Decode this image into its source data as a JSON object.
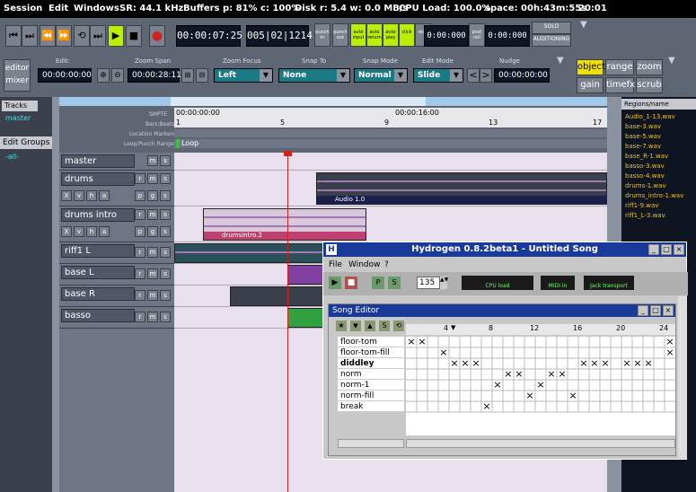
{
  "menubar": {
    "items": [
      "Session",
      "Edit",
      "Windows"
    ],
    "status": [
      "SR: 44.1 kHz",
      "Buffers p: 81% c: 100%",
      "Disk r: 5.4 w: 0.0 MB/s",
      "CPU Load: 100.0%",
      "space: 00h:43m:55s",
      "20:01"
    ]
  },
  "transport": {
    "clock1": "00:00:07:25",
    "clock2": "005|02|1214",
    "buttons": [
      {
        "label": "punch in"
      },
      {
        "label": "punch out"
      },
      {
        "label": "auto input"
      },
      {
        "label": "auto return"
      },
      {
        "label": "auto play"
      },
      {
        "label": "click"
      },
      {
        "label": "stop"
      }
    ],
    "clock3": "0:00:000",
    "clock4": "0:00:000",
    "preroll": "pre roll",
    "postroll": "post roll",
    "sold_label": "SOLO",
    "audition_label": "AUDITIONING"
  },
  "toolbar2": {
    "editor_label": "editor",
    "mixer_label": "mixer",
    "edit_label": "Edit:",
    "edit_value": "00:00:00:00",
    "zoom_span_label": "Zoom Span",
    "zoom_span_value": "00:00:28:11",
    "zoom_focus_label": "Zoom Focus",
    "zoom_focus_value": "Left",
    "snap_to_label": "Snap To",
    "snap_to_value": "None",
    "snap_mode_label": "Snap Mode",
    "snap_mode_value": "Normal",
    "edit_mode_label": "Edit Mode",
    "edit_mode_value": "Slide",
    "nudge_label": "Nudge",
    "nudge_value": "00:00:00:00",
    "modes": [
      "object",
      "range",
      "zoom",
      "gain",
      "timefx",
      "scrub"
    ]
  },
  "left": {
    "tracks_tab": "Tracks",
    "tracks_item": "master",
    "edit_groups_tab": "Edit Groups",
    "all_label": "-all-"
  },
  "ruler": {
    "labels": [
      "SMPTE",
      "Bars:Beats",
      "Location Markers",
      "Loop/Punch Ranges"
    ],
    "smpte_values": [
      "00:00:00:00",
      "00:00:16:00"
    ],
    "bar_values": [
      "1",
      "5",
      "9",
      "13",
      "17"
    ],
    "loop_label": "Loop"
  },
  "tracks": [
    {
      "name": "master"
    },
    {
      "name": "drums"
    },
    {
      "name": "drums intro"
    },
    {
      "name": "riff1 L"
    },
    {
      "name": "base L"
    },
    {
      "name": "base R"
    },
    {
      "name": "basso"
    }
  ],
  "regions": {
    "drums_region": "Audio 1.0",
    "drums_intro_region": "drumsintro.2"
  },
  "region_list": {
    "header": "Regions/name",
    "items": [
      "Audio_1-13.wav",
      "base-3.wav",
      "base-5.wav",
      "base-7.wav",
      "base_R-1.wav",
      "basso-3.wav",
      "basso-4.wav",
      "drums-1.wav",
      "drums_intro-1.wav",
      "riff1-9.wav",
      "riff1_L-3.wav"
    ]
  },
  "hydrogen": {
    "title": "Hydrogen 0.8.2beta1 - Untitled Song",
    "menu": [
      "File",
      "Window",
      "?"
    ],
    "bpm": "135",
    "cpu_label": "CPU load",
    "midi_label": "MIDI in",
    "jack_label": "Jack transport",
    "song_editor_title": "Song Editor",
    "patterns": [
      "floor-tom",
      "floor-tom-fill",
      "diddley",
      "norm",
      "norm-1",
      "norm-fill",
      "break"
    ],
    "ruler_numbers": [
      "4",
      "8",
      "12",
      "16",
      "20",
      "24"
    ]
  },
  "colors": {
    "accent_green": "#b8f000",
    "mode_yellow": "#f0e000",
    "record_red": "#d02020",
    "hydro_blue": "#1a3a9a",
    "region_orange": "#f0c020"
  }
}
